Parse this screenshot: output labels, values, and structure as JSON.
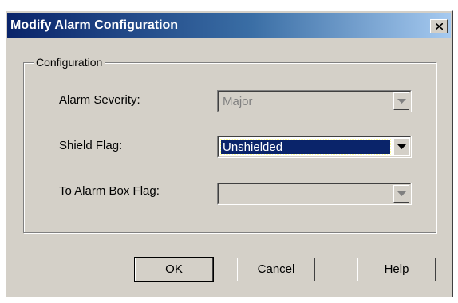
{
  "dialog": {
    "title": "Modify Alarm Configuration",
    "close_glyph": "close-icon"
  },
  "group": {
    "title": "Configuration"
  },
  "fields": {
    "alarm_severity": {
      "label": "Alarm Severity:",
      "value": "Major",
      "enabled": false
    },
    "shield_flag": {
      "label": "Shield Flag:",
      "value": "Unshielded",
      "enabled": true
    },
    "to_alarm_box_flag": {
      "label": "To Alarm Box Flag:",
      "value": "",
      "enabled": false
    }
  },
  "buttons": {
    "ok": "OK",
    "cancel": "Cancel",
    "help": "Help"
  },
  "colors": {
    "title_bar_start": "#0a246a",
    "title_bar_end": "#a6caf0",
    "dialog_face": "#d4d0c8",
    "selection": "#0a246a"
  }
}
